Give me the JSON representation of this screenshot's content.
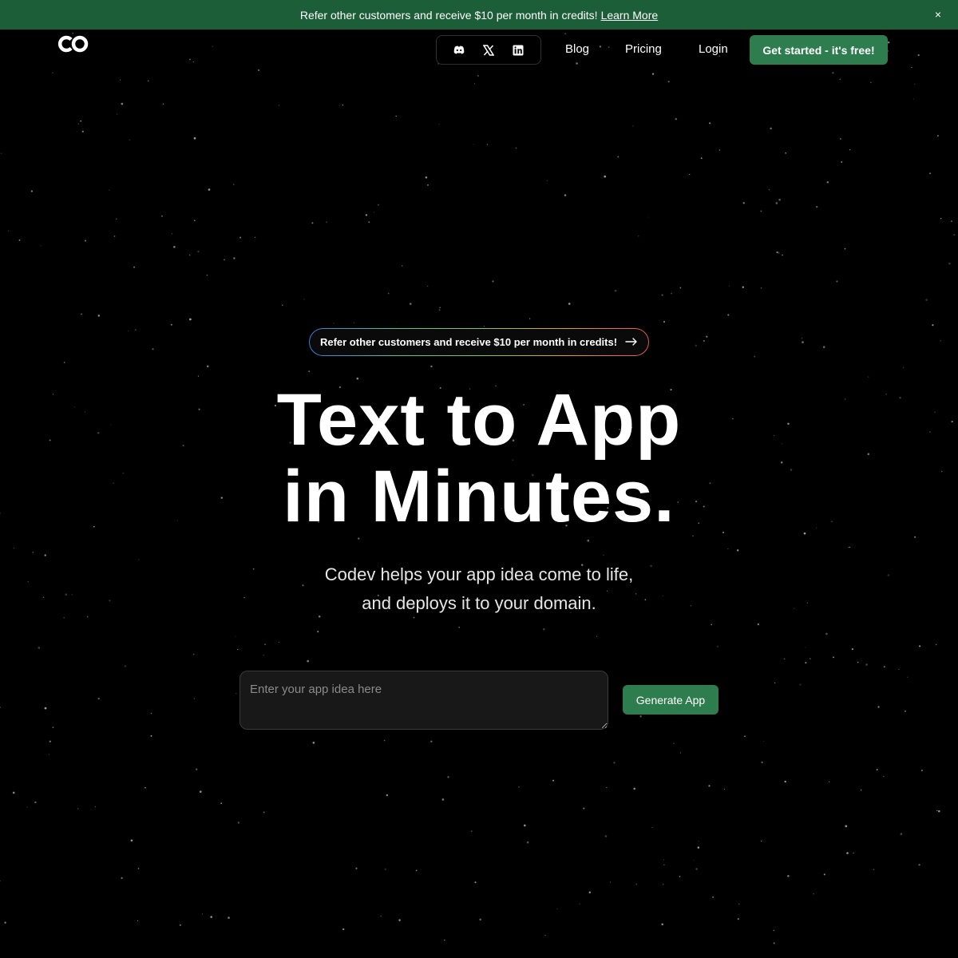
{
  "banner": {
    "text": "Refer other customers and receive $10 per month in credits!",
    "link": "Learn More",
    "close": "×"
  },
  "brand": {
    "logo_icon": "codev-logo-icon"
  },
  "socials": [
    {
      "icon": "discord-icon"
    },
    {
      "icon": "x-twitter-icon"
    },
    {
      "icon": "linkedin-icon"
    }
  ],
  "nav": {
    "blog": "Blog",
    "pricing": "Pricing",
    "login": "Login",
    "cta": "Get started - it's free!"
  },
  "hero": {
    "pill": "Refer other customers and receive $10 per month in credits!",
    "pill_icon": "arrow-right-icon",
    "title_line1": "Text to App",
    "title_line2": "in Minutes.",
    "subtitle_line1": "Codev helps your app idea come to life,",
    "subtitle_line2": "and deploys it to your domain."
  },
  "idea_form": {
    "placeholder": "Enter your app idea here",
    "value": "",
    "button": "Generate App"
  },
  "colors": {
    "background": "#000000",
    "banner": "#1b5e37",
    "accent": "#2e7d4f"
  }
}
